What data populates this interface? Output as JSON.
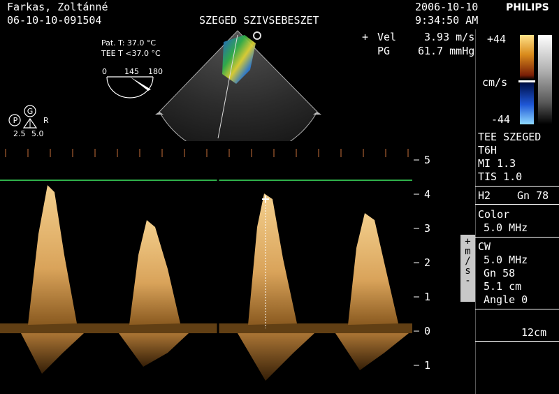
{
  "header": {
    "patient_name": "Farkas, Zoltánné",
    "patient_id": "06-10-10-091504",
    "institution": "SZEGED SZIVSEBESZET",
    "date": "2006-10-10",
    "time": "9:34:50 AM",
    "brand": "PHILIPS"
  },
  "temps": {
    "pat_t": "Pat. T: 37.0 °C",
    "tee_t": "TEE T <37.0 °C"
  },
  "angle_dial": {
    "min": "0",
    "current": "145",
    "max": "180"
  },
  "probe_marker": {
    "p": "P",
    "g": "G",
    "r": "R",
    "freq_low": "2.5",
    "freq_high": "5.0"
  },
  "measurements": {
    "plus": "+",
    "vel_label": "Vel",
    "vel_value": "3.93 m/s",
    "pg_label": "PG",
    "pg_value": "61.7 mmHg"
  },
  "color_scale": {
    "top": "+44",
    "unit": "cm/s",
    "bottom": "-44"
  },
  "right_panel": {
    "site": "TEE SZEGED",
    "probe": "T6H",
    "mi": "MI 1.3",
    "tis": "TIS 1.0",
    "harmonic": "H2",
    "gain": "Gn 78",
    "color_label": "Color",
    "color_freq": "5.0 MHz",
    "cw_label": "CW",
    "cw_freq": "5.0 MHz",
    "cw_gain": "Gn 58",
    "cw_depth": "5.1 cm",
    "cw_angle": "Angle 0",
    "depth": "12cm"
  },
  "velocity_axis": {
    "unit_chars": [
      "+",
      "m",
      "/",
      "s",
      "-"
    ],
    "ticks": [
      "5",
      "4",
      "3",
      "2",
      "1",
      "0",
      "1"
    ]
  }
}
